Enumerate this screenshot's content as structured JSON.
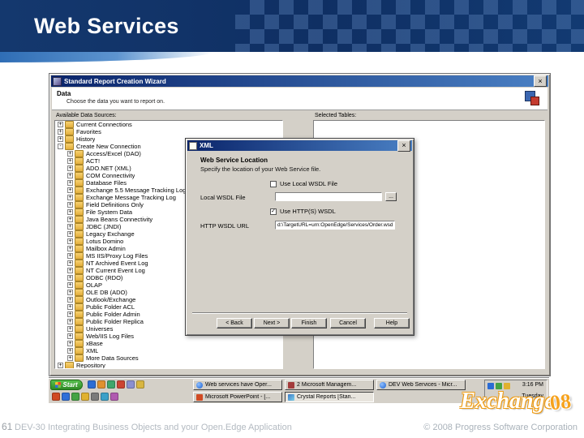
{
  "slide": {
    "title": "Web Services",
    "number": "61",
    "footer_left": "DEV-30 Integrating Business Objects and your Open.Edge Application",
    "footer_right": "© 2008 Progress Software Corporation",
    "logo_word": "Exchange",
    "logo_year": "08"
  },
  "wizard": {
    "title": "Standard Report Creation Wizard",
    "section_title": "Data",
    "section_desc": "Choose the data you want to report on.",
    "available_label": "Available Data Sources:",
    "selected_label": "Selected Tables:",
    "tree": [
      {
        "label": "Current Connections",
        "cls": "root",
        "expander": "+"
      },
      {
        "label": "Favorites",
        "cls": "root",
        "expander": "+"
      },
      {
        "label": "History",
        "cls": "root",
        "expander": "+"
      },
      {
        "label": "Create New Connection",
        "cls": "root",
        "expander": "-"
      },
      {
        "label": "Access/Excel (DAO)",
        "cls": "sub",
        "expander": "+"
      },
      {
        "label": "ACT!",
        "cls": "sub",
        "expander": "+"
      },
      {
        "label": "ADO.NET (XML)",
        "cls": "sub",
        "expander": "+"
      },
      {
        "label": "COM Connectivity",
        "cls": "sub",
        "expander": "+"
      },
      {
        "label": "Database Files",
        "cls": "sub",
        "expander": "+"
      },
      {
        "label": "Exchange 5.5 Message Tracking Log",
        "cls": "sub",
        "expander": "+"
      },
      {
        "label": "Exchange Message Tracking Log",
        "cls": "sub",
        "expander": "+"
      },
      {
        "label": "Field Definitions Only",
        "cls": "sub",
        "expander": "+"
      },
      {
        "label": "File System Data",
        "cls": "sub",
        "expander": "+"
      },
      {
        "label": "Java Beans Connectivity",
        "cls": "sub",
        "expander": "+"
      },
      {
        "label": "JDBC (JNDI)",
        "cls": "sub",
        "expander": "+"
      },
      {
        "label": "Legacy Exchange",
        "cls": "sub",
        "expander": "+"
      },
      {
        "label": "Lotus Domino",
        "cls": "sub",
        "expander": "+"
      },
      {
        "label": "Mailbox Admin",
        "cls": "sub",
        "expander": "+"
      },
      {
        "label": "MS IIS/Proxy Log Files",
        "cls": "sub",
        "expander": "+"
      },
      {
        "label": "NT Archived Event Log",
        "cls": "sub",
        "expander": "+"
      },
      {
        "label": "NT Current Event Log",
        "cls": "sub",
        "expander": "+"
      },
      {
        "label": "ODBC (RDO)",
        "cls": "sub",
        "expander": "+"
      },
      {
        "label": "OLAP",
        "cls": "sub",
        "expander": "+"
      },
      {
        "label": "OLE DB (ADO)",
        "cls": "sub",
        "expander": "+"
      },
      {
        "label": "Outlook/Exchange",
        "cls": "sub",
        "expander": "+"
      },
      {
        "label": "Public Folder ACL",
        "cls": "sub",
        "expander": "+"
      },
      {
        "label": "Public Folder Admin",
        "cls": "sub",
        "expander": "+"
      },
      {
        "label": "Public Folder Replica",
        "cls": "sub",
        "expander": "+"
      },
      {
        "label": "Universes",
        "cls": "sub",
        "expander": "+"
      },
      {
        "label": "Web/IIS Log Files",
        "cls": "sub",
        "expander": "+"
      },
      {
        "label": "xBase",
        "cls": "sub",
        "expander": "+"
      },
      {
        "label": "XML",
        "cls": "sub",
        "expander": "+"
      },
      {
        "label": "More Data Sources",
        "cls": "sub",
        "expander": "+"
      },
      {
        "label": "Repository",
        "cls": "root",
        "expander": "+"
      }
    ]
  },
  "xml_dialog": {
    "title": "XML",
    "heading": "Web Service Location",
    "sub": "Specify the location of your Web Service file.",
    "use_local_label": "Use Local WSDL File",
    "local_label": "Local WSDL File",
    "local_value": "",
    "browse_label": "...",
    "use_http_label": "Use HTTP(S) WSDL",
    "url_label": "HTTP WSDL URL",
    "url_value": "d:\\TargetURL=urn:OpenEdge/Services/Order.wsdl",
    "buttons": [
      "< Back",
      "Next >",
      "Finish",
      "Cancel",
      "Help"
    ]
  },
  "taskbar": {
    "start_label": "Start",
    "row1": [
      {
        "label": "Web services have Oper...",
        "icon": "ie"
      },
      {
        "label": "2 Microsoft Managem...",
        "icon": "mmc"
      },
      {
        "label": "DEV Web Services - Micr...",
        "icon": "ie"
      }
    ],
    "row2": [
      {
        "label": "Microsoft PowerPoint - [...",
        "icon": "ppt"
      },
      {
        "label": "Crystal Reports [Stan...",
        "icon": "cr",
        "state": "active"
      }
    ],
    "clock": "3:16 PM",
    "day": "Tuesday"
  }
}
